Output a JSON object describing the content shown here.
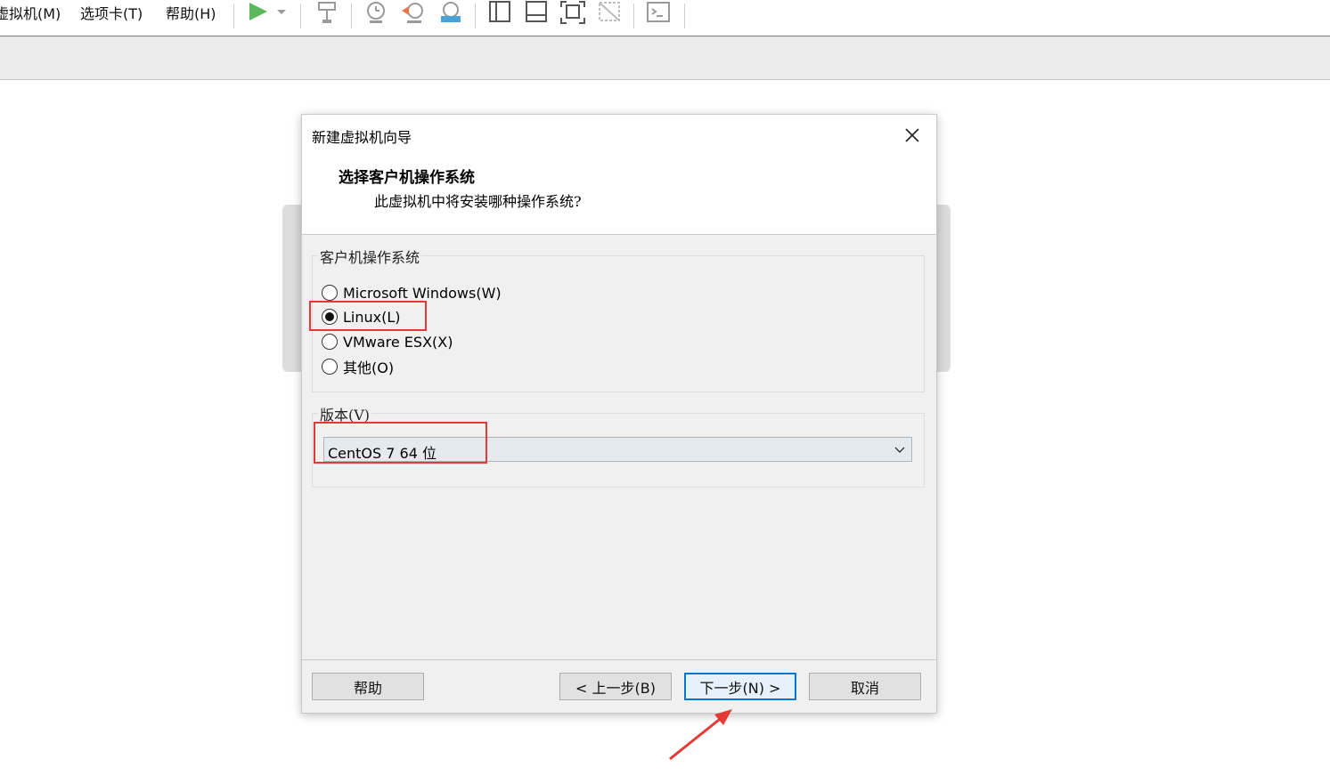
{
  "menu": {
    "items": [
      "虚拟机(M)",
      "选项卡(T)",
      "帮助(H)"
    ]
  },
  "toolbar": {
    "icons": [
      "play-icon",
      "dropdown-arrow-icon",
      "send-keys-icon",
      "snapshot-icon",
      "revert-snapshot-icon",
      "manage-snapshots-icon",
      "library-view-icon",
      "thumbnail-view-icon",
      "fullscreen-icon",
      "unity-icon",
      "console-icon"
    ]
  },
  "dialog": {
    "title": "新建虚拟机向导",
    "heading": "选择客户机操作系统",
    "subheading": "此虚拟机中将安装哪种操作系统?",
    "os_group_label": "客户机操作系统",
    "os_options": [
      {
        "label": "Microsoft Windows(W)",
        "selected": false
      },
      {
        "label": "Linux(L)",
        "selected": true
      },
      {
        "label": "VMware ESX(X)",
        "selected": false
      },
      {
        "label": "其他(O)",
        "selected": false
      }
    ],
    "version_group_label": "版本(V)",
    "version_value": "CentOS 7 64 位",
    "buttons": {
      "help": "帮助",
      "back": "< 上一步(B)",
      "next": "下一步(N) >",
      "cancel": "取消"
    }
  },
  "colors": {
    "highlight": "#e53935",
    "accent": "#0078d7",
    "play": "#5cb85c"
  }
}
